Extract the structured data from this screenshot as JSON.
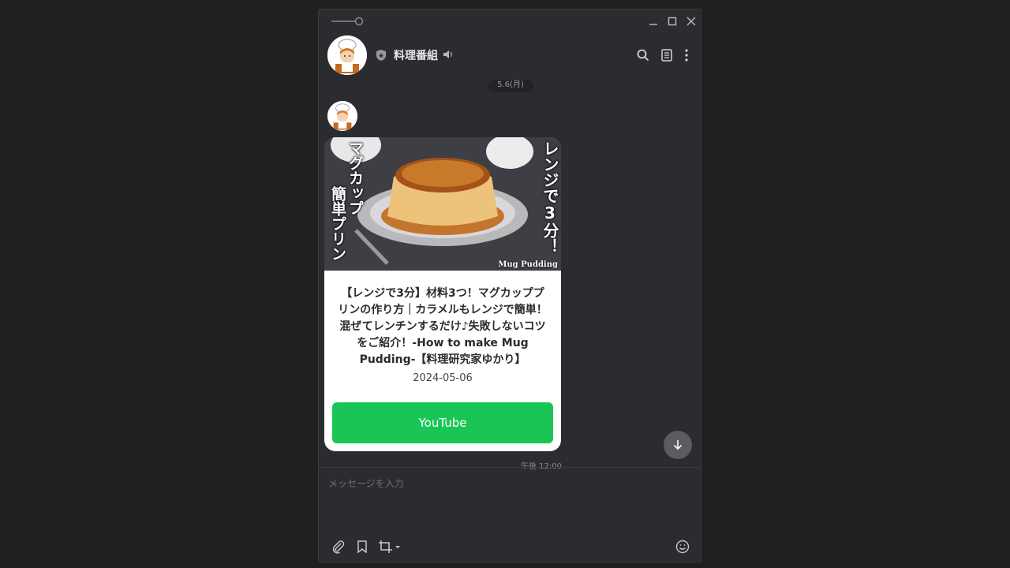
{
  "window": {
    "title": "料理番組",
    "date_label": "5.6(月)"
  },
  "message": {
    "thumbnail": {
      "left_text": "マグカップ",
      "left_text2": "簡単プリン",
      "right_text": "レンジで3分！",
      "caption": "Mug Pudding"
    },
    "title": "【レンジで3分】材料3つ！マグカッププリンの作り方｜カラメルもレンジで簡単！混ぜてレンチンするだけ♪失敗しないコツをご紹介！-How to make Mug Pudding-【料理研究家ゆかり】",
    "date": "2024-05-06",
    "button_label": "YouTube",
    "time": "午後 12:00"
  },
  "input": {
    "placeholder": "メッセージを入力"
  },
  "colors": {
    "accent": "#19c655",
    "background": "#2b2c30"
  },
  "icons": [
    "pin-icon",
    "minimize-icon",
    "maximize-icon",
    "close-icon",
    "shield-icon",
    "speaker-icon",
    "search-icon",
    "notes-icon",
    "more-icon",
    "arrow-down-icon",
    "attach-icon",
    "bookmark-icon",
    "crop-icon",
    "emoji-icon"
  ]
}
